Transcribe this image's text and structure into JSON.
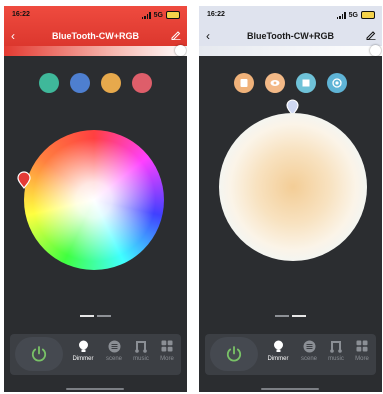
{
  "screens": [
    {
      "status": {
        "time": "16:22",
        "network": "5G"
      },
      "header": {
        "title": "BlueTooth-CW+RGB",
        "back_icon": "chevron-left-icon",
        "edit_icon": "edit-pencil-icon"
      },
      "presets": {
        "colors": [
          "#3fb89a",
          "#4e7fd0",
          "#e7a94c",
          "#de5e6a"
        ]
      },
      "bottom": {
        "power_icon": "power-icon",
        "nav": [
          {
            "label": "Dimmer",
            "icon": "bulb-icon",
            "active": true
          },
          {
            "label": "scene",
            "icon": "scene-icon",
            "active": false
          },
          {
            "label": "music",
            "icon": "music-icon",
            "active": false
          },
          {
            "label": "More",
            "icon": "grid-icon",
            "active": false
          }
        ]
      }
    },
    {
      "status": {
        "time": "16:22",
        "network": "5G"
      },
      "header": {
        "title": "BlueTooth-CW+RGB",
        "back_icon": "chevron-left-icon",
        "edit_icon": "edit-pencil-icon"
      },
      "scene_buttons": [
        {
          "icon": "reading-icon",
          "color": "#f0b27a"
        },
        {
          "icon": "eye-icon",
          "color": "#f3b987"
        },
        {
          "icon": "square-icon",
          "color": "#6fc2d8"
        },
        {
          "icon": "target-icon",
          "color": "#5fb4d6"
        }
      ],
      "bottom": {
        "power_icon": "power-icon",
        "nav": [
          {
            "label": "Dimmer",
            "icon": "bulb-icon",
            "active": true
          },
          {
            "label": "scene",
            "icon": "scene-icon",
            "active": false
          },
          {
            "label": "music",
            "icon": "music-icon",
            "active": false
          },
          {
            "label": "More",
            "icon": "grid-icon",
            "active": false
          }
        ]
      }
    }
  ]
}
